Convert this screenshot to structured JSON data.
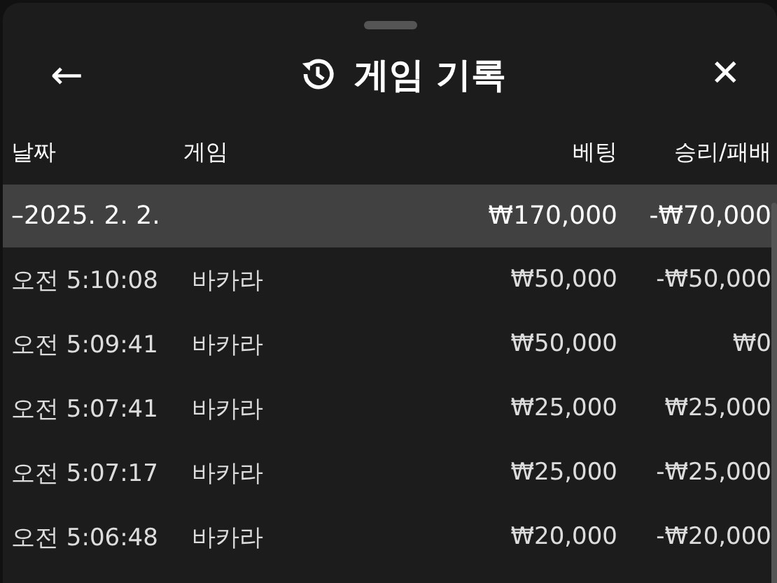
{
  "header": {
    "title": "게임 기록",
    "back": "←",
    "close": "✕"
  },
  "table": {
    "columns": [
      "날짜",
      "게임",
      "베팅",
      "승리/패배"
    ],
    "group": {
      "date": "–2025. 2. 2.",
      "bet": "₩170,000",
      "result": "-₩70,000",
      "selected": true
    },
    "rows": [
      {
        "time": "오전 5:10:08",
        "game": "바카라",
        "bet": "₩50,000",
        "result": "-₩50,000"
      },
      {
        "time": "오전 5:09:41",
        "game": "바카라",
        "bet": "₩50,000",
        "result": "₩0"
      },
      {
        "time": "오전 5:07:41",
        "game": "바카라",
        "bet": "₩25,000",
        "result": "₩25,000"
      },
      {
        "time": "오전 5:07:17",
        "game": "바카라",
        "bet": "₩25,000",
        "result": "-₩25,000"
      },
      {
        "time": "오전 5:06:48",
        "game": "바카라",
        "bet": "₩20,000",
        "result": "-₩20,000"
      }
    ]
  }
}
